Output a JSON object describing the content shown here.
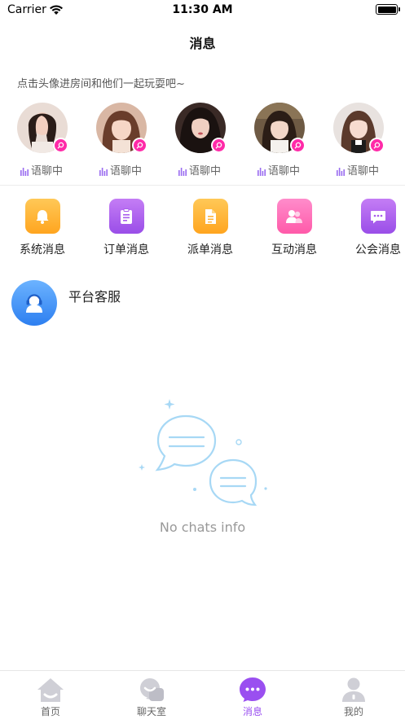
{
  "status_bar": {
    "carrier": "Carrier",
    "time": "11:30 AM"
  },
  "nav": {
    "title": "消息"
  },
  "hint": "点击头像进房间和他们一起玩耍吧~",
  "rooms": [
    {
      "status": "语聊中"
    },
    {
      "status": "语聊中"
    },
    {
      "status": "语聊中"
    },
    {
      "status": "语聊中"
    },
    {
      "status": "语聊中"
    }
  ],
  "shortcuts": [
    {
      "label": "系统消息",
      "icon": "bell-icon",
      "color": "#ffb43a"
    },
    {
      "label": "订单消息",
      "icon": "clipboard-icon",
      "color": "#b064ee"
    },
    {
      "label": "派单消息",
      "icon": "document-icon",
      "color": "#ffb43a"
    },
    {
      "label": "互动消息",
      "icon": "users-icon",
      "color": "#ff6fb8"
    },
    {
      "label": "公会消息",
      "icon": "chat-icon",
      "color": "#b064ee"
    }
  ],
  "customer_service": {
    "name": "平台客服",
    "icon": "headset-icon"
  },
  "empty_state": {
    "text": "No chats info",
    "icon": "chat-bubbles-icon"
  },
  "tabbar": {
    "active_color": "#9a4ff0",
    "items": [
      {
        "label": "首页",
        "icon": "home-icon"
      },
      {
        "label": "聊天室",
        "icon": "chatroom-icon"
      },
      {
        "label": "消息",
        "icon": "message-icon"
      },
      {
        "label": "我的",
        "icon": "profile-icon"
      }
    ]
  }
}
